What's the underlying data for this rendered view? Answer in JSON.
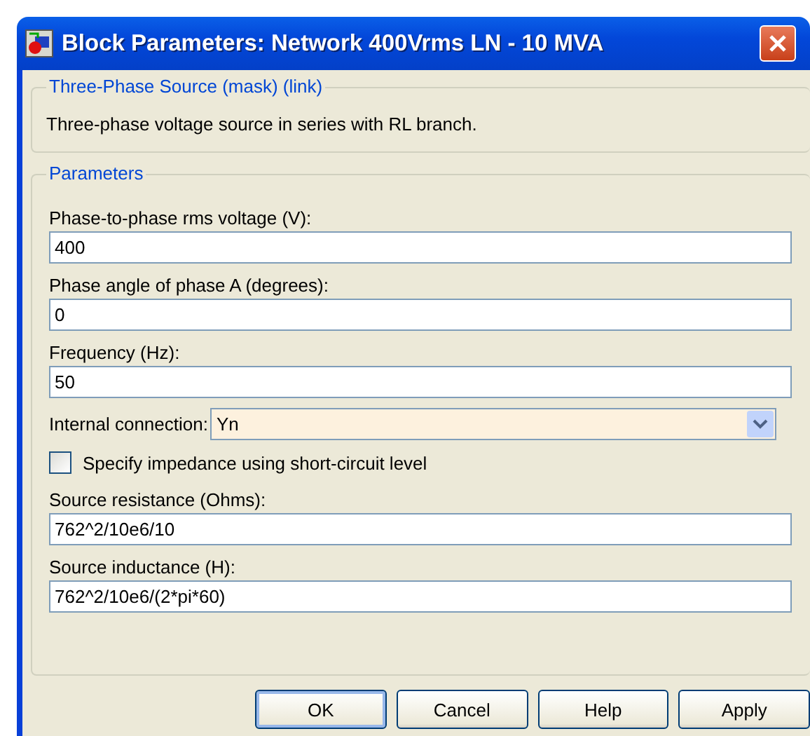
{
  "window": {
    "title": "Block Parameters: Network 400Vrms LN - 10 MVA"
  },
  "description": {
    "legend": "Three-Phase Source (mask) (link)",
    "text": "Three-phase voltage source in series with RL branch."
  },
  "parameters": {
    "legend": "Parameters",
    "items": [
      {
        "kind": "text",
        "label": "Phase-to-phase rms voltage (V):",
        "value": "400"
      },
      {
        "kind": "text",
        "label": "Phase angle of phase A (degrees):",
        "value": "0"
      },
      {
        "kind": "text",
        "label": "Frequency (Hz):",
        "value": "50"
      },
      {
        "kind": "dropdown",
        "label": "Internal connection:",
        "value": "Yn"
      },
      {
        "kind": "checkbox",
        "label": "Specify impedance using short-circuit level",
        "checked": false
      },
      {
        "kind": "text",
        "label": "Source resistance (Ohms):",
        "value": "762^2/10e6/10"
      },
      {
        "kind": "text",
        "label": "Source inductance (H):",
        "value": "762^2/10e6/(2*pi*60)"
      }
    ]
  },
  "buttons": [
    {
      "label": "OK",
      "default": true
    },
    {
      "label": "Cancel",
      "default": false
    },
    {
      "label": "Help",
      "default": false
    },
    {
      "label": "Apply",
      "default": false
    }
  ]
}
